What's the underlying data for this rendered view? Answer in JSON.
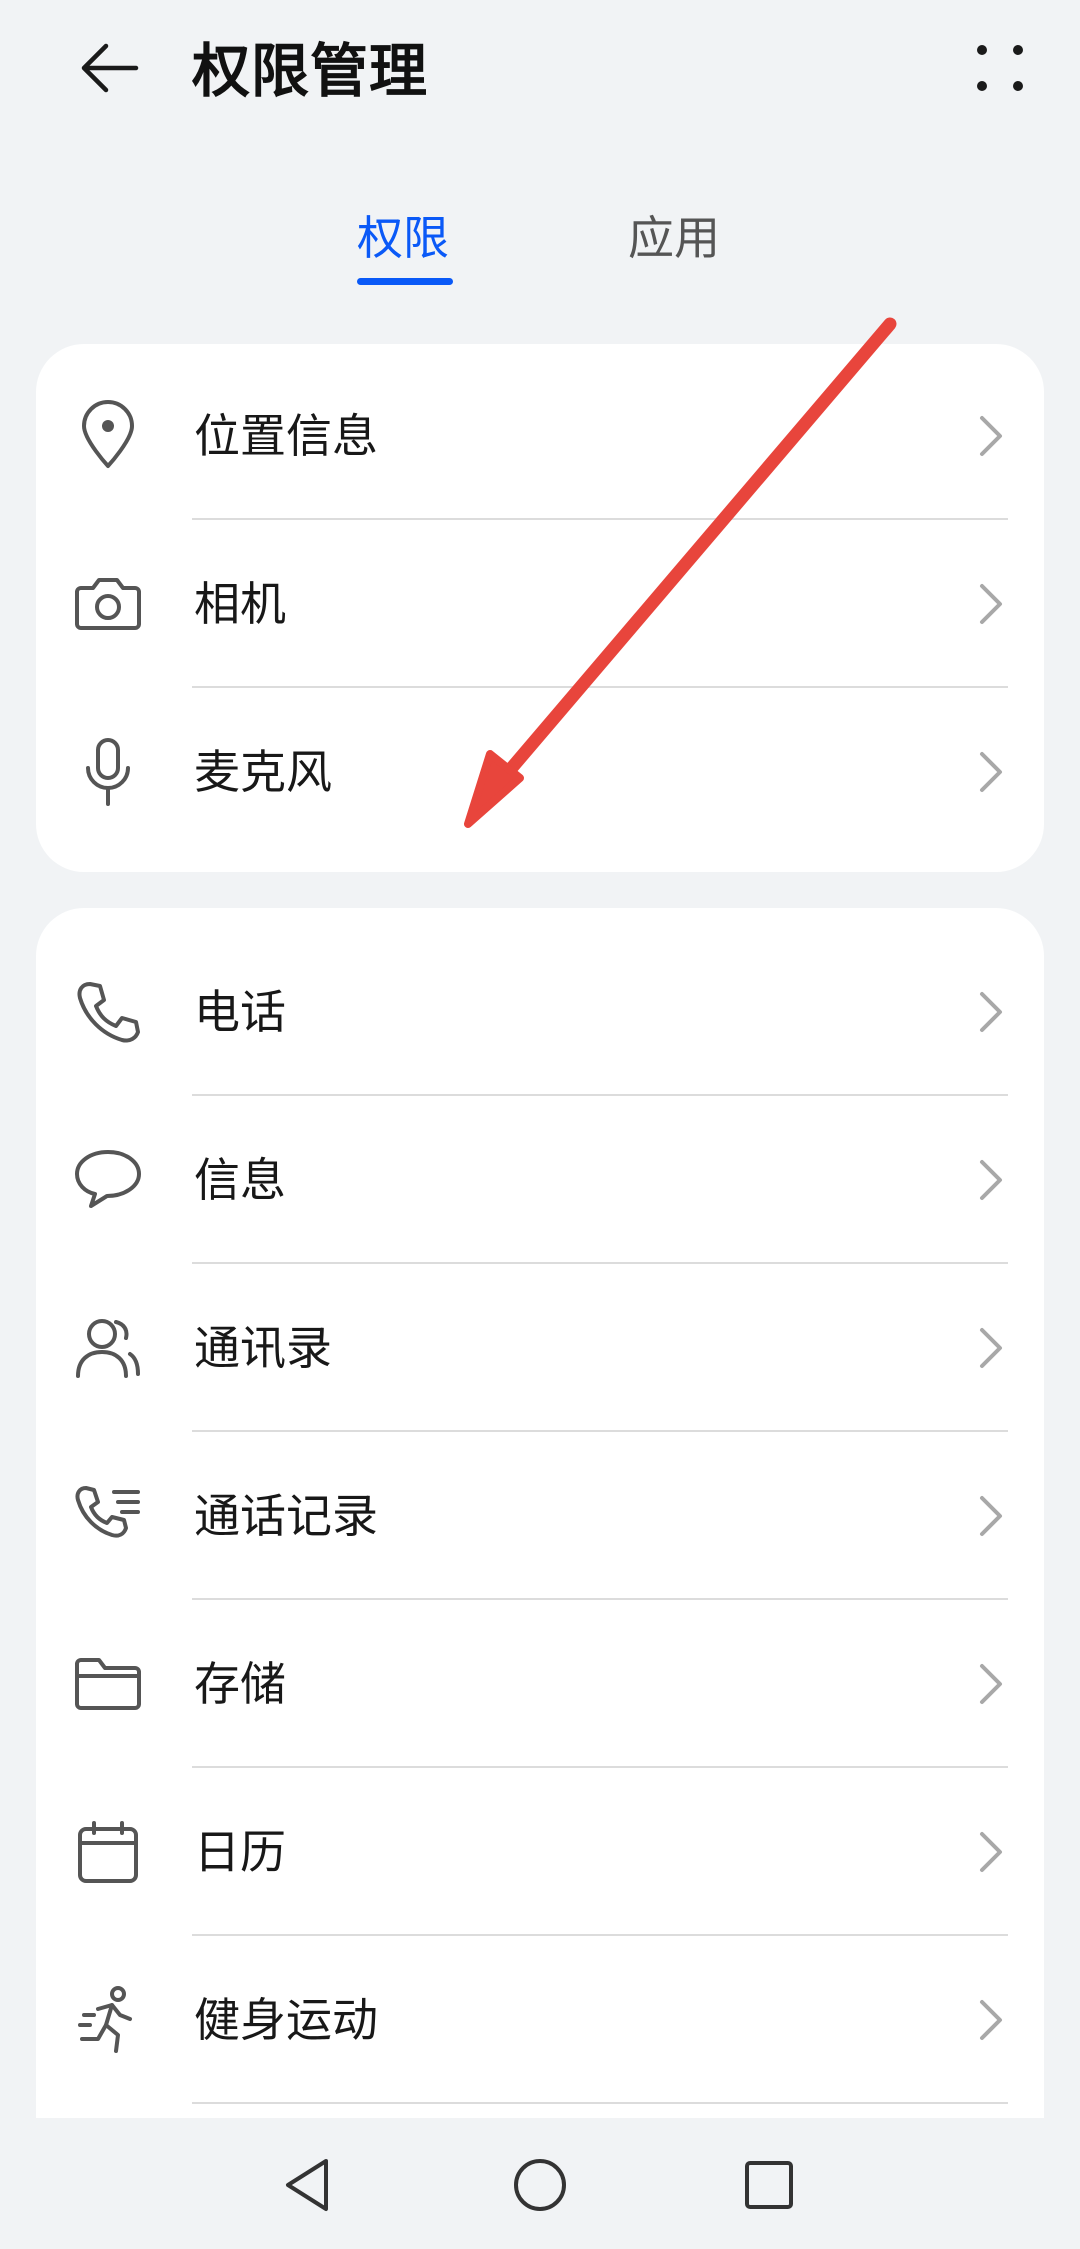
{
  "header": {
    "title": "权限管理",
    "back_icon": "arrow-left-icon",
    "more_icon": "more-grid-icon"
  },
  "tabs": [
    {
      "label": "权限",
      "active": true
    },
    {
      "label": "应用",
      "active": false
    }
  ],
  "colors": {
    "accent": "#0a59f7",
    "background": "#f1f3f5",
    "card": "#ffffff",
    "annotation_arrow": "#e8453c"
  },
  "group1": [
    {
      "label": "位置信息",
      "icon": "location-pin-icon"
    },
    {
      "label": "相机",
      "icon": "camera-icon"
    },
    {
      "label": "麦克风",
      "icon": "microphone-icon"
    }
  ],
  "group2": [
    {
      "label": "电话",
      "icon": "phone-icon"
    },
    {
      "label": "信息",
      "icon": "message-bubble-icon"
    },
    {
      "label": "通讯录",
      "icon": "contacts-icon"
    },
    {
      "label": "通话记录",
      "icon": "call-log-icon"
    },
    {
      "label": "存储",
      "icon": "folder-icon"
    },
    {
      "label": "日历",
      "icon": "calendar-icon"
    },
    {
      "label": "健身运动",
      "icon": "running-icon"
    }
  ],
  "navbar": {
    "back_icon": "nav-back-triangle-icon",
    "home_icon": "nav-home-circle-icon",
    "recents_icon": "nav-recents-square-icon"
  }
}
